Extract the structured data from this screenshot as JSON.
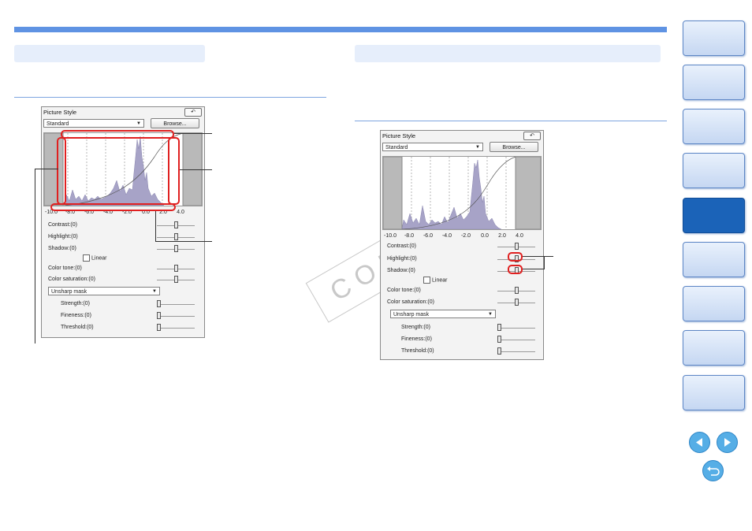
{
  "watermark": "COPY",
  "panel": {
    "title": "Picture Style",
    "reset_icon": "return-arrow-icon",
    "style_value": "Standard",
    "browse_label": "Browse...",
    "axis_ticks": [
      "-10.0",
      "-8.0",
      "-6.0",
      "-4.0",
      "-2.0",
      "0.0",
      "2.0",
      "4.0"
    ],
    "contrast_label": "Contrast:(0)",
    "highlight_label": "Highlight:(0)",
    "shadow_label": "Shadow:(0)",
    "linear_label": "Linear",
    "color_tone_label": "Color tone:(0)",
    "color_saturation_label": "Color saturation:(0)",
    "unsharp_value": "Unsharp mask",
    "strength_label": "Strength:(0)",
    "fineness_label": "Fineness:(0)",
    "threshold_label": "Threshold:(0)"
  },
  "colors": {
    "accent": "#5f93e3",
    "section_bar": "#e6eefb",
    "highlight_box": "#e02020",
    "active_tab": "#1b63b8",
    "nav_button": "#56aee6"
  },
  "nav": {
    "tabs_count": 9,
    "active_tab": 5,
    "prev_icon": "triangle-left-icon",
    "next_icon": "triangle-right-icon",
    "back_icon": "return-icon"
  }
}
